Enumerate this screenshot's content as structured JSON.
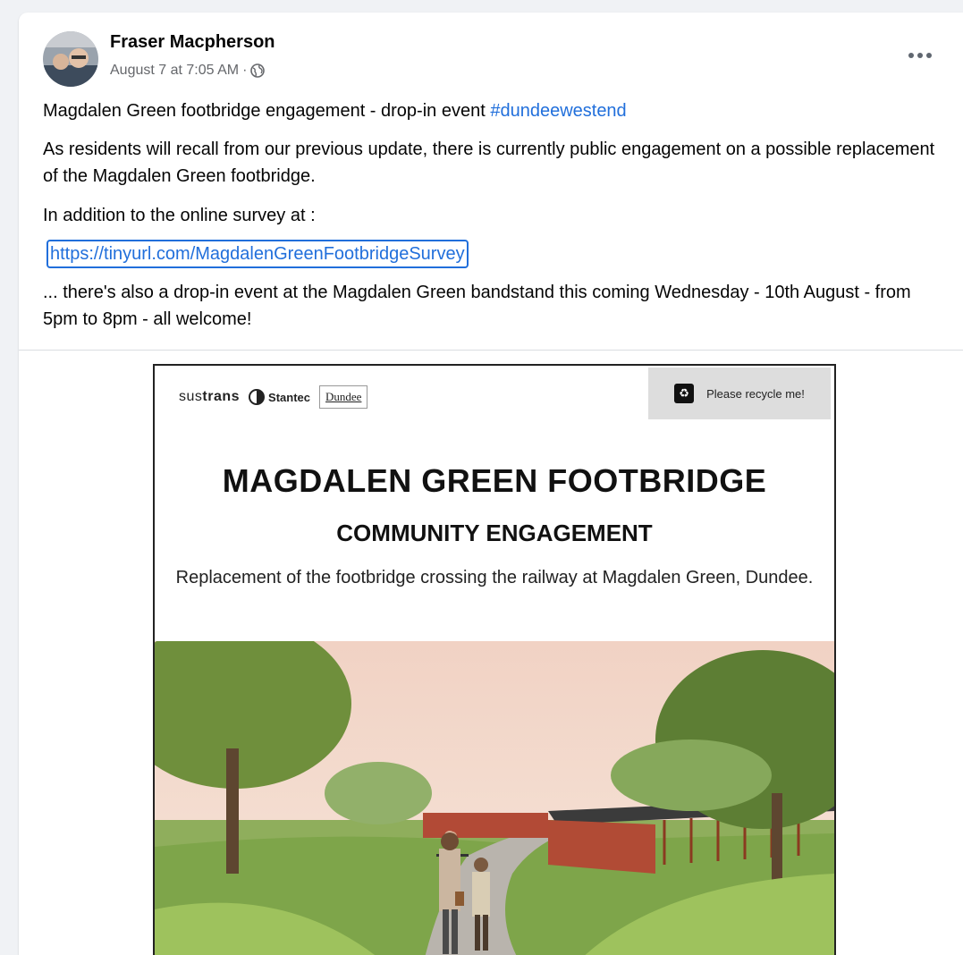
{
  "post": {
    "author": "Fraser Macpherson",
    "timestamp": "August 7 at 7:05 AM",
    "separator": "·",
    "privacy_icon": "globe-icon",
    "more_icon": "ellipsis-icon",
    "title_text": "Magdalen Green footbridge engagement - drop-in event ",
    "hashtag": "#dundeewestend",
    "paragraph1": "As residents will recall from our previous update, there is currently public engagement on a possible replacement of the Magdalen Green footbridge.",
    "paragraph2": "In addition to the online survey at :",
    "link": "https://tinyurl.com/MagdalenGreenFootbridgeSurvey",
    "paragraph3": "... there's also a drop-in event at the Magdalen Green bandstand this coming Wednesday - 10th August - from 5pm to 8pm - all welcome!"
  },
  "poster": {
    "logo_sustrans_a": "sus",
    "logo_sustrans_b": "trans",
    "logo_stantec": "Stantec",
    "logo_dundee": "Dundee",
    "recycle_text": "Please recycle me!",
    "title": "MAGDALEN GREEN FOOTBRIDGE",
    "subtitle": "COMMUNITY ENGAGEMENT",
    "description": "Replacement of the footbridge crossing the railway at Magdalen Green, Dundee."
  },
  "colors": {
    "link": "#216fdb",
    "meta": "#65676b",
    "background": "#f0f2f5"
  }
}
